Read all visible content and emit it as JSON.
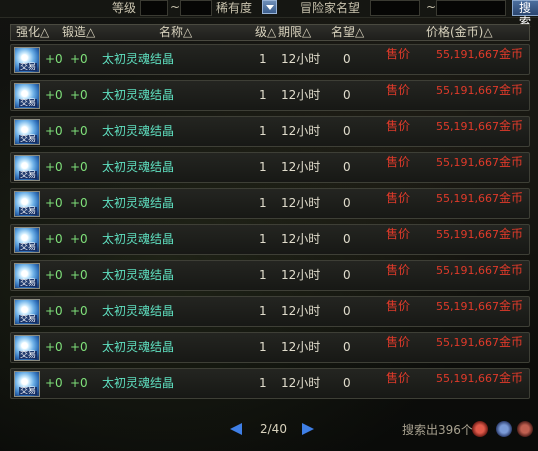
{
  "top": {
    "level_label": "等级",
    "tilde1": "~",
    "rarity_label": "稀有度",
    "adventurer_label": "冒险家名望",
    "tilde2": "~",
    "search_label": "搜索"
  },
  "header": {
    "enhance": "强化△",
    "forge": "锻造△",
    "name": "名称△",
    "level": "级△",
    "period": "期限△",
    "reputation": "名望△",
    "price": "价格(金币)△"
  },
  "rows": [
    {
      "icon": "crystal-icon",
      "trade": "交易",
      "enhance": "+0",
      "forge": "+0",
      "name": "太初灵魂结晶",
      "level": "1",
      "period": "12小时",
      "reputation": "0",
      "sell": "售价",
      "price": "55,191,667",
      "unit": "金币"
    },
    {
      "icon": "crystal-icon",
      "trade": "交易",
      "enhance": "+0",
      "forge": "+0",
      "name": "太初灵魂结晶",
      "level": "1",
      "period": "12小时",
      "reputation": "0",
      "sell": "售价",
      "price": "55,191,667",
      "unit": "金币"
    },
    {
      "icon": "crystal-icon",
      "trade": "交易",
      "enhance": "+0",
      "forge": "+0",
      "name": "太初灵魂结晶",
      "level": "1",
      "period": "12小时",
      "reputation": "0",
      "sell": "售价",
      "price": "55,191,667",
      "unit": "金币"
    },
    {
      "icon": "crystal-icon",
      "trade": "交易",
      "enhance": "+0",
      "forge": "+0",
      "name": "太初灵魂结晶",
      "level": "1",
      "period": "12小时",
      "reputation": "0",
      "sell": "售价",
      "price": "55,191,667",
      "unit": "金币"
    },
    {
      "icon": "crystal-icon",
      "trade": "交易",
      "enhance": "+0",
      "forge": "+0",
      "name": "太初灵魂结晶",
      "level": "1",
      "period": "12小时",
      "reputation": "0",
      "sell": "售价",
      "price": "55,191,667",
      "unit": "金币"
    },
    {
      "icon": "crystal-icon",
      "trade": "交易",
      "enhance": "+0",
      "forge": "+0",
      "name": "太初灵魂结晶",
      "level": "1",
      "period": "12小时",
      "reputation": "0",
      "sell": "售价",
      "price": "55,191,667",
      "unit": "金币"
    },
    {
      "icon": "crystal-icon",
      "trade": "交易",
      "enhance": "+0",
      "forge": "+0",
      "name": "太初灵魂结晶",
      "level": "1",
      "period": "12小时",
      "reputation": "0",
      "sell": "售价",
      "price": "55,191,667",
      "unit": "金币"
    },
    {
      "icon": "crystal-icon",
      "trade": "交易",
      "enhance": "+0",
      "forge": "+0",
      "name": "太初灵魂结晶",
      "level": "1",
      "period": "12小时",
      "reputation": "0",
      "sell": "售价",
      "price": "55,191,667",
      "unit": "金币"
    },
    {
      "icon": "crystal-icon",
      "trade": "交易",
      "enhance": "+0",
      "forge": "+0",
      "name": "太初灵魂结晶",
      "level": "1",
      "period": "12小时",
      "reputation": "0",
      "sell": "售价",
      "price": "55,191,667",
      "unit": "金币"
    },
    {
      "icon": "crystal-icon",
      "trade": "交易",
      "enhance": "+0",
      "forge": "+0",
      "name": "太初灵魂结晶",
      "level": "1",
      "period": "12小时",
      "reputation": "0",
      "sell": "售价",
      "price": "55,191,667",
      "unit": "金币"
    }
  ],
  "pager": {
    "page": "2/40",
    "result_count": "搜索出396个"
  },
  "colors": {
    "sell_red": "#e03a2a",
    "name_teal": "#5fe0c0",
    "enhance_green": "#7fe07a",
    "pager_blue": "#3f7fe6"
  }
}
